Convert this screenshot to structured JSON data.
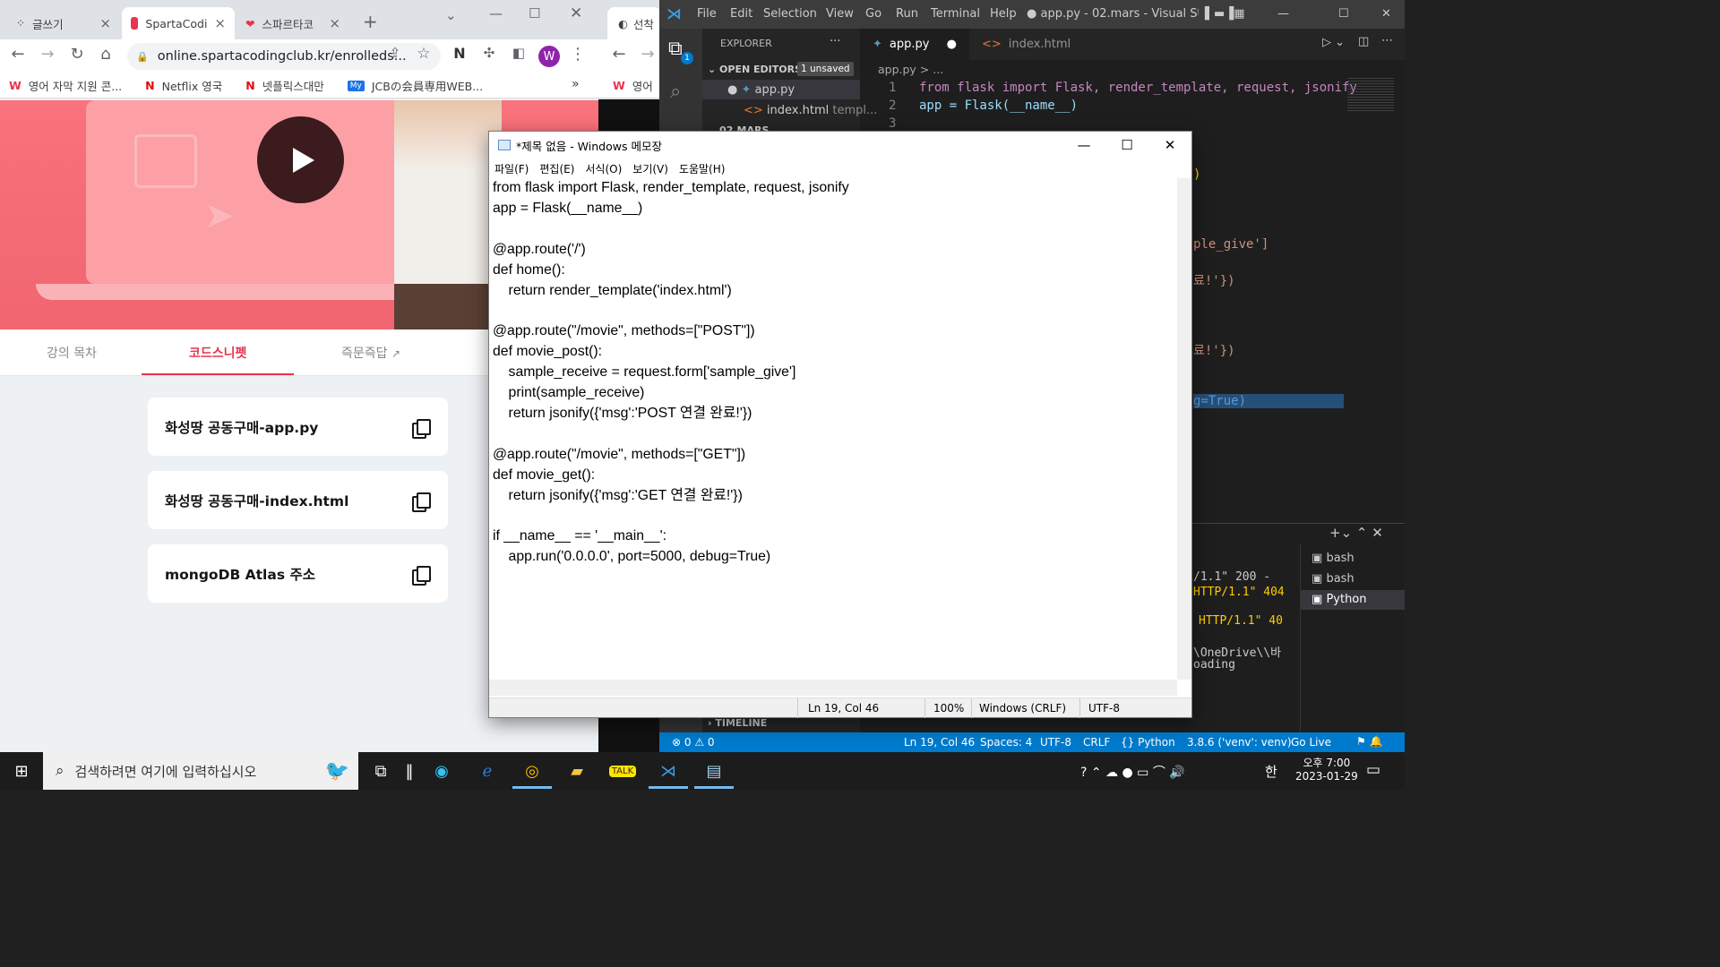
{
  "chrome": {
    "tabs": [
      {
        "label": "글쓰기"
      },
      {
        "label": "SpartaCodi"
      },
      {
        "label": "스파르타코"
      }
    ],
    "url": "online.spartacodingclub.kr/enrolleds...",
    "profile_letter": "W",
    "bookmarks": [
      "영어 자막 지원 콘...",
      "Netflix 영국",
      "넷플릭스대만",
      "JCBの会員専用WEB..."
    ],
    "bookmarks_more": "»",
    "course_tabs": [
      "강의 목차",
      "코드스니펫",
      "즉문즉답"
    ],
    "snippets": [
      "화성땅 공동구매-app.py",
      "화성땅 공동구매-index.html",
      "mongoDB Atlas 주소"
    ]
  },
  "chrome2": {
    "tab_label": "선착",
    "bookmark_label": "영어"
  },
  "vscode": {
    "menu": [
      "File",
      "Edit",
      "Selection",
      "View",
      "Go",
      "Run",
      "Terminal",
      "Help"
    ],
    "title": "● app.py - 02.mars - Visual Studio ...",
    "explorer_label": "EXPLORER",
    "explorer_more": "···",
    "open_editors_label": "OPEN EDITORS",
    "unsaved_badge": "1 unsaved",
    "open_editor_files": [
      "app.py",
      "index.html"
    ],
    "open_editor_file_desc": "templ...",
    "folder_label": "02.MARS",
    "timeline_label": "TIMELINE",
    "editor_tabs": [
      "app.py",
      "index.html"
    ],
    "breadcrumb": "app.py > ...",
    "line_numbers": [
      "1",
      "2",
      "3"
    ],
    "code_line1": "from flask import Flask, render_template, request, jsonify",
    "code_line2": "app = Flask(__name__)",
    "code_fragments": [
      ")",
      "ple_give']",
      "료!'})",
      "료!'})",
      "g=True)"
    ],
    "terminal_fragments": [
      "/1.1\" 200 -",
      "HTTP/1.1\" 404",
      "HTTP/1.1\" 40",
      "\\OneDrive\\\\바",
      "oading"
    ],
    "terminals": [
      "bash",
      "bash",
      "Python"
    ],
    "status_left": "⊗ 0 ⚠ 0",
    "status_items": [
      "Ln 19, Col 46",
      "Spaces: 4",
      "UTF-8",
      "CRLF",
      "{} Python",
      "3.8.6 ('venv': venv)",
      "Go Live"
    ]
  },
  "notepad": {
    "title": "*제목 없음 - Windows 메모장",
    "menu": [
      "파일(F)",
      "편집(E)",
      "서식(O)",
      "보기(V)",
      "도움말(H)"
    ],
    "content": "from flask import Flask, render_template, request, jsonify\napp = Flask(__name__)\n\n@app.route('/')\ndef home():\n    return render_template('index.html')\n\n@app.route(\"/movie\", methods=[\"POST\"])\ndef movie_post():\n    sample_receive = request.form['sample_give']\n    print(sample_receive)\n    return jsonify({'msg':'POST 연결 완료!'})\n\n@app.route(\"/movie\", methods=[\"GET\"])\ndef movie_get():\n    return jsonify({'msg':'GET 연결 완료!'})\n\nif __name__ == '__main__':\n    app.run('0.0.0.0', port=5000, debug=True)",
    "status": {
      "position": "Ln 19, Col 46",
      "zoom": "100%",
      "line_ending": "Windows (CRLF)",
      "encoding": "UTF-8"
    }
  },
  "taskbar": {
    "search_placeholder": "검색하려면 여기에 입력하십시오",
    "ime": "한",
    "time": "오후 7:00",
    "date": "2023-01-29"
  },
  "colors": {
    "brand": "#e8344e",
    "vscode_blue": "#007acc",
    "hero": "#f06570"
  }
}
